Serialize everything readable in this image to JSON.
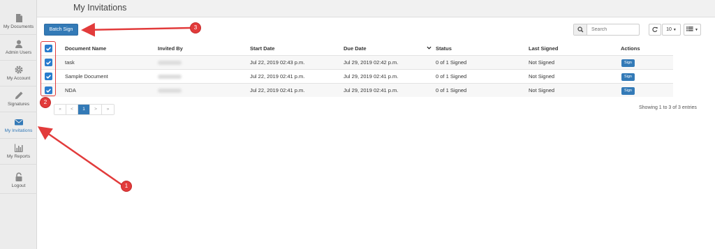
{
  "sidebar": {
    "items": [
      {
        "label": "My Documents",
        "icon": "document-icon",
        "active": false
      },
      {
        "label": "Admin Users",
        "icon": "user-icon",
        "active": false
      },
      {
        "label": "My Account",
        "icon": "gear-icon",
        "active": false
      },
      {
        "label": "Signatures",
        "icon": "pen-icon",
        "active": false
      },
      {
        "label": "My Invitations",
        "icon": "envelope-icon",
        "active": true
      },
      {
        "label": "My Reports",
        "icon": "bar-chart-icon",
        "active": false
      },
      {
        "label": "Logout",
        "icon": "lock-icon",
        "active": false
      }
    ]
  },
  "header": {
    "title": "My Invitations"
  },
  "toolbar": {
    "batch_sign_label": "Batch Sign",
    "search_placeholder": "Search",
    "page_size": "10"
  },
  "table": {
    "columns": [
      "Document Name",
      "Invited By",
      "Start Date",
      "Due Date",
      "Status",
      "Last Signed",
      "Actions"
    ],
    "rows": [
      {
        "document_name": "task",
        "invited_by": "",
        "start_date": "Jul 22, 2019 02:43 p.m.",
        "due_date": "Jul 29, 2019 02:42 p.m.",
        "status": "0 of 1 Signed",
        "last_signed": "Not Signed",
        "action": "Sign",
        "checked": true
      },
      {
        "document_name": "Sample Document",
        "invited_by": "",
        "start_date": "Jul 22, 2019 02:41 p.m.",
        "due_date": "Jul 29, 2019 02:41 p.m.",
        "status": "0 of 1 Signed",
        "last_signed": "Not Signed",
        "action": "Sign",
        "checked": true
      },
      {
        "document_name": "NDA",
        "invited_by": "",
        "start_date": "Jul 22, 2019 02:41 p.m.",
        "due_date": "Jul 29, 2019 02:41 p.m.",
        "status": "0 of 1 Signed",
        "last_signed": "Not Signed",
        "action": "Sign",
        "checked": true
      }
    ]
  },
  "pagination": {
    "first": "«",
    "prev": "<",
    "current": "1",
    "next": ">",
    "last": "»",
    "summary": "Showing 1 to 3 of 3 entries"
  },
  "annotations": {
    "badge_1": "1",
    "badge_2": "2",
    "badge_3": "3",
    "color": "#e23b3b"
  },
  "colors": {
    "accent": "#337ab7",
    "checkbox": "#2a7ccd",
    "sidebar_bg": "#ececec"
  }
}
